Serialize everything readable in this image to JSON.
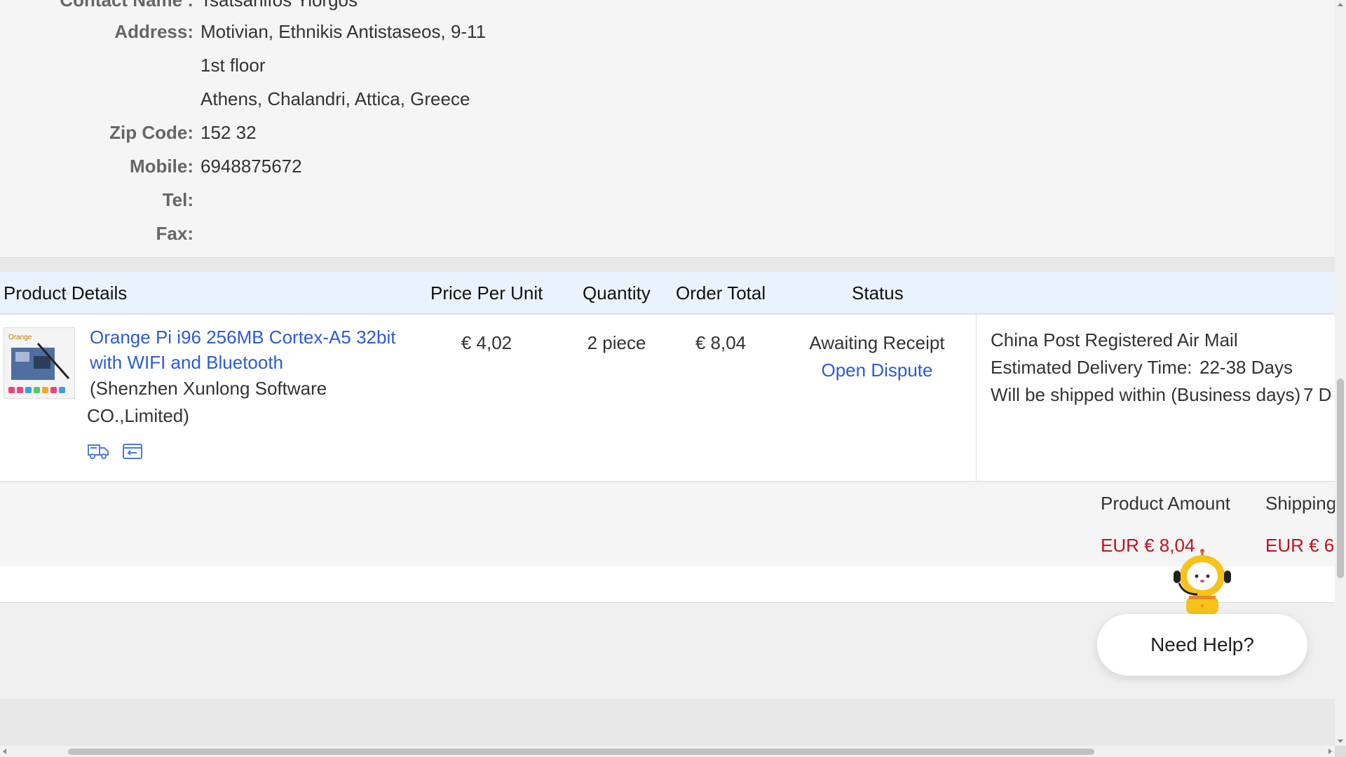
{
  "address": {
    "contact_label": "Contact Name :",
    "contact_value": "Tsatsanifos Yiorgos",
    "address_label": "Address:",
    "address_line1": "Motivian, Ethnikis Antistaseos, 9-11",
    "address_line2": "1st floor",
    "address_line3": "Athens, Chalandri, Attica, Greece",
    "zip_label": "Zip Code:",
    "zip_value": "152 32",
    "mobile_label": "Mobile:",
    "mobile_value": "6948875672",
    "tel_label": "Tel:",
    "tel_value": "",
    "fax_label": "Fax:",
    "fax_value": ""
  },
  "table": {
    "headers": {
      "product": "Product Details",
      "price": "Price Per Unit",
      "quantity": "Quantity",
      "total": "Order Total",
      "status": "Status"
    },
    "item": {
      "title": "Orange Pi i96 256MB Cortex-A5 32bit with WIFI and Bluetooth",
      "seller": "(Shenzhen Xunlong Software CO.,Limited)",
      "price": "€ 4,02",
      "quantity": "2 piece",
      "total": "€ 8,04",
      "status": "Awaiting Receipt",
      "dispute_link": "Open Dispute",
      "icons": [
        "truck-icon",
        "return-icon"
      ],
      "shipping": {
        "method": "China Post Registered Air Mail",
        "delivery_label": "Estimated Delivery Time:",
        "delivery_value": "22-38 Days",
        "ship_within_label": "Will be shipped within (Business days)",
        "ship_within_value": "7 D"
      }
    }
  },
  "totals": {
    "product_amount_label": "Product Amount",
    "product_amount_value": "EUR € 8,04",
    "shipping_label": "Shipping",
    "shipping_value": "EUR € 6"
  },
  "help": {
    "label": "Need Help?",
    "icon": "robot-assistant-icon"
  },
  "colors": {
    "link": "#2d5bd1",
    "price_red": "#c0121f",
    "header_bg": "#eaf2fd",
    "bot_yellow": "#f7c21a"
  }
}
